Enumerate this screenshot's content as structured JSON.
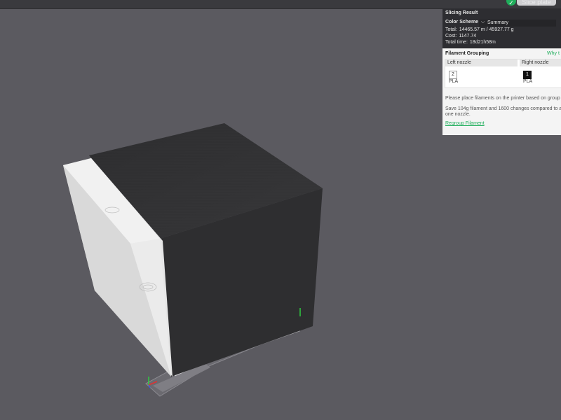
{
  "toolbar": {
    "slice_label": "Slice plate",
    "check_glyph": "✓",
    "check_icon": "check-icon"
  },
  "slicing_result": {
    "title": "Slicing Result",
    "color_scheme_label": "Color Scheme",
    "color_scheme_value": "Summary",
    "chevron_icon": "chevron-down-icon",
    "total_label": "Total:",
    "total_value": "14465.57 m / 45927.77 g",
    "cost_label": "Cost:",
    "cost_value": "1147.74",
    "time_label": "Total time:",
    "time_value": "18d21h58m"
  },
  "filament_grouping": {
    "title": "Filament Grouping",
    "why_link": "Why t",
    "left_nozzle": {
      "label": "Left nozzle",
      "slot": "2",
      "material": "PLA"
    },
    "right_nozzle": {
      "label": "Right nozzle",
      "slot": "1",
      "material": "PLA"
    },
    "message1": "Please place filaments on the printer based on group",
    "message2": "Save 104g filament and 1600 changes compared to a one nozzle.",
    "regroup_link": "Regroup Filament"
  },
  "colors": {
    "viewport_bg": "#5b5a60",
    "panel_dark": "#2d2d31",
    "panel_light": "#f4f4f4",
    "accent_green": "#1fae5b",
    "model_dark": "#2e2e30",
    "model_light": "#e4e4e4"
  }
}
